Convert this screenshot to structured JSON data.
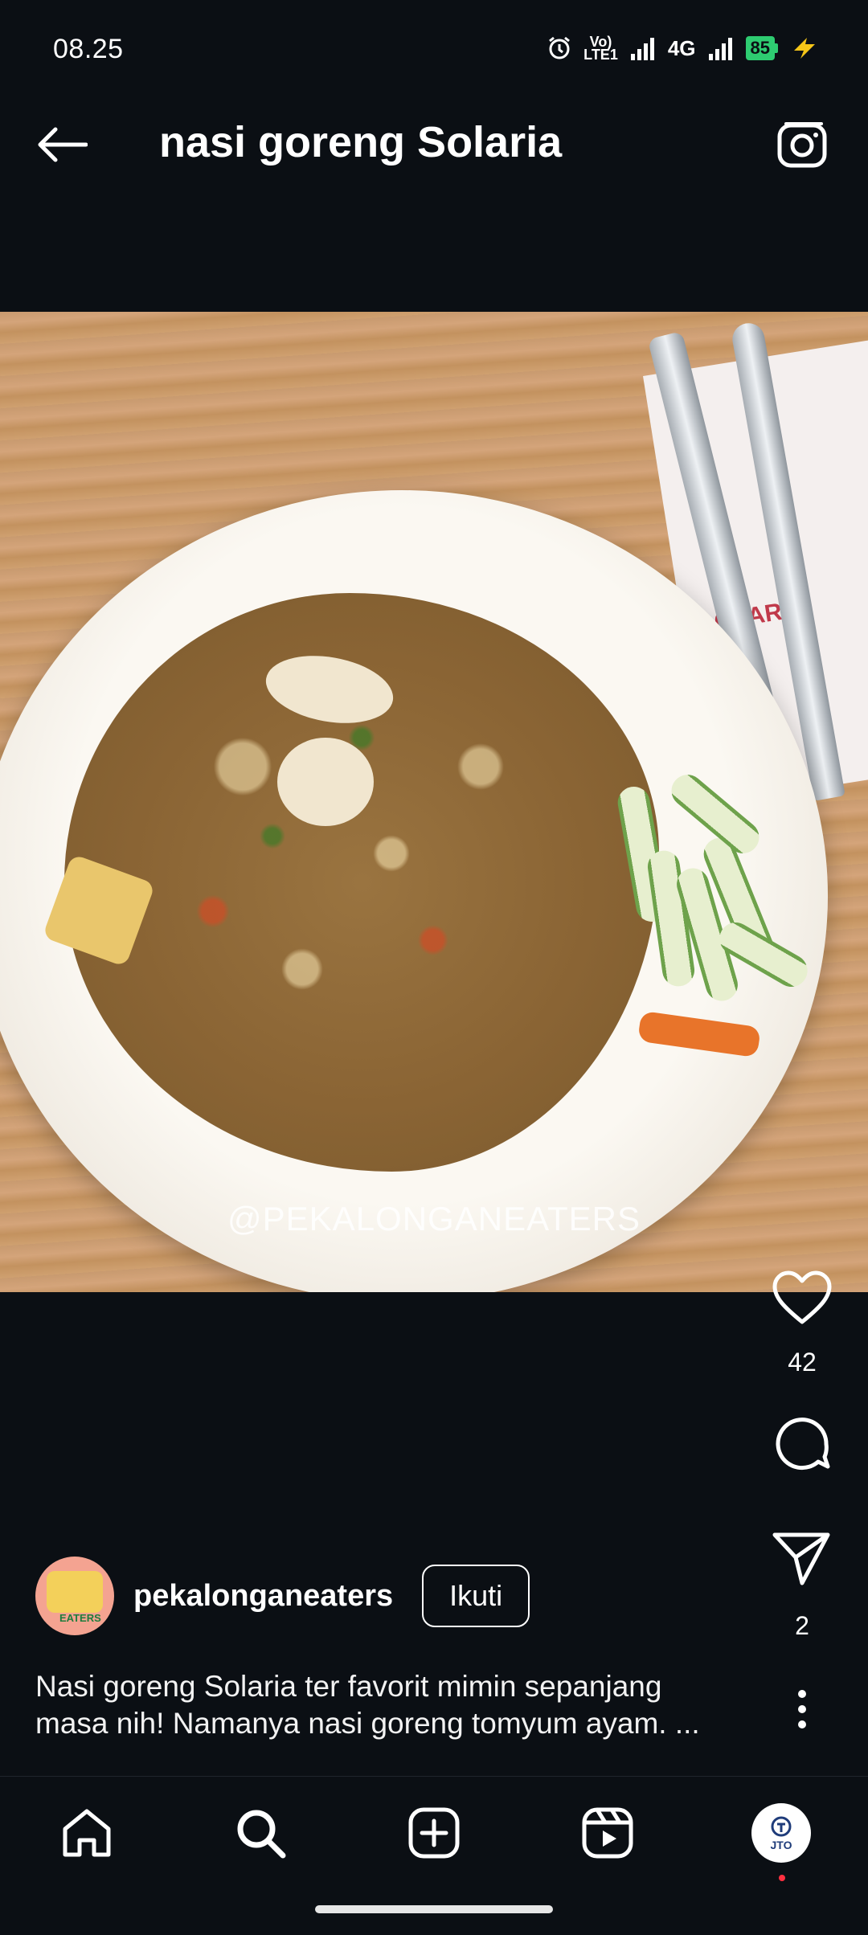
{
  "status_bar": {
    "time": "08.25",
    "volte_label": "Vo)\nLTE1",
    "network": "4G",
    "battery": "85"
  },
  "header": {
    "title": "nasi goreng Solaria"
  },
  "post": {
    "watermark": "@PEKALONGANEATERS",
    "napkin_text": "OLARIA",
    "likes": "42",
    "shares": "2",
    "author": "pekalonganeaters",
    "follow_label": "Ikuti",
    "avatar_text": "EATERS",
    "caption": "Nasi goreng Solaria ter favorit mimin sepanjang masa nih! Namanya nasi goreng tomyum ayam. ..."
  },
  "bottom_nav": {
    "profile_text": "JTO"
  },
  "colors": {
    "background": "#0b0f14",
    "text": "#ffffff",
    "battery": "#2ecc71",
    "notification_dot": "#ff3040"
  }
}
